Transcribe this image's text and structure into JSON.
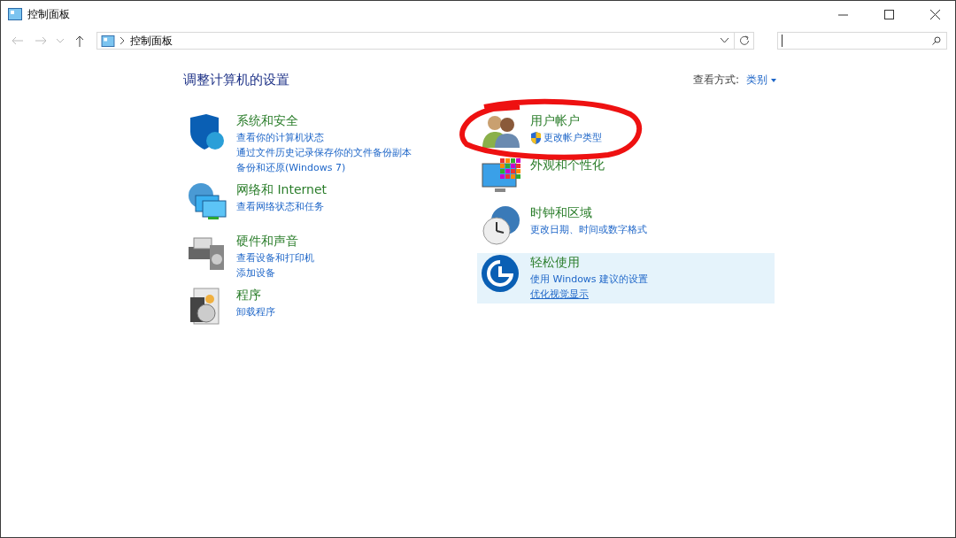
{
  "window": {
    "title": "控制面板"
  },
  "address_bar": {
    "path": "控制面板"
  },
  "heading": "调整计算机的设置",
  "view_by": {
    "label": "查看方式:",
    "value": "类别"
  },
  "columns": [
    {
      "categories": [
        {
          "kind": "security",
          "title": "系统和安全",
          "highlighted": false,
          "links": [
            {
              "text": "查看你的计算机状态",
              "shield": false,
              "hovered": false
            },
            {
              "text": "通过文件历史记录保存你的文件备份副本",
              "shield": false,
              "hovered": false
            },
            {
              "text": "备份和还原(Windows 7)",
              "shield": false,
              "hovered": false
            }
          ]
        },
        {
          "kind": "network",
          "title": "网络和 Internet",
          "highlighted": false,
          "links": [
            {
              "text": "查看网络状态和任务",
              "shield": false,
              "hovered": false
            }
          ]
        },
        {
          "kind": "hardware",
          "title": "硬件和声音",
          "highlighted": false,
          "links": [
            {
              "text": "查看设备和打印机",
              "shield": false,
              "hovered": false
            },
            {
              "text": "添加设备",
              "shield": false,
              "hovered": false
            }
          ]
        },
        {
          "kind": "programs",
          "title": "程序",
          "highlighted": false,
          "links": [
            {
              "text": "卸载程序",
              "shield": false,
              "hovered": false
            }
          ]
        }
      ]
    },
    {
      "categories": [
        {
          "kind": "users",
          "title": "用户帐户",
          "highlighted": false,
          "links": [
            {
              "text": "更改帐户类型",
              "shield": true,
              "hovered": false
            }
          ]
        },
        {
          "kind": "appearance",
          "title": "外观和个性化",
          "highlighted": false
        },
        {
          "kind": "clock",
          "title": "时钟和区域",
          "highlighted": false,
          "links": [
            {
              "text": "更改日期、时间或数字格式",
              "shield": false,
              "hovered": false
            }
          ]
        },
        {
          "kind": "access",
          "title": "轻松使用",
          "highlighted": true,
          "links": [
            {
              "text": "使用 Windows 建议的设置",
              "shield": false,
              "hovered": false
            },
            {
              "text": "优化视觉显示",
              "shield": false,
              "hovered": true
            }
          ]
        }
      ]
    }
  ]
}
